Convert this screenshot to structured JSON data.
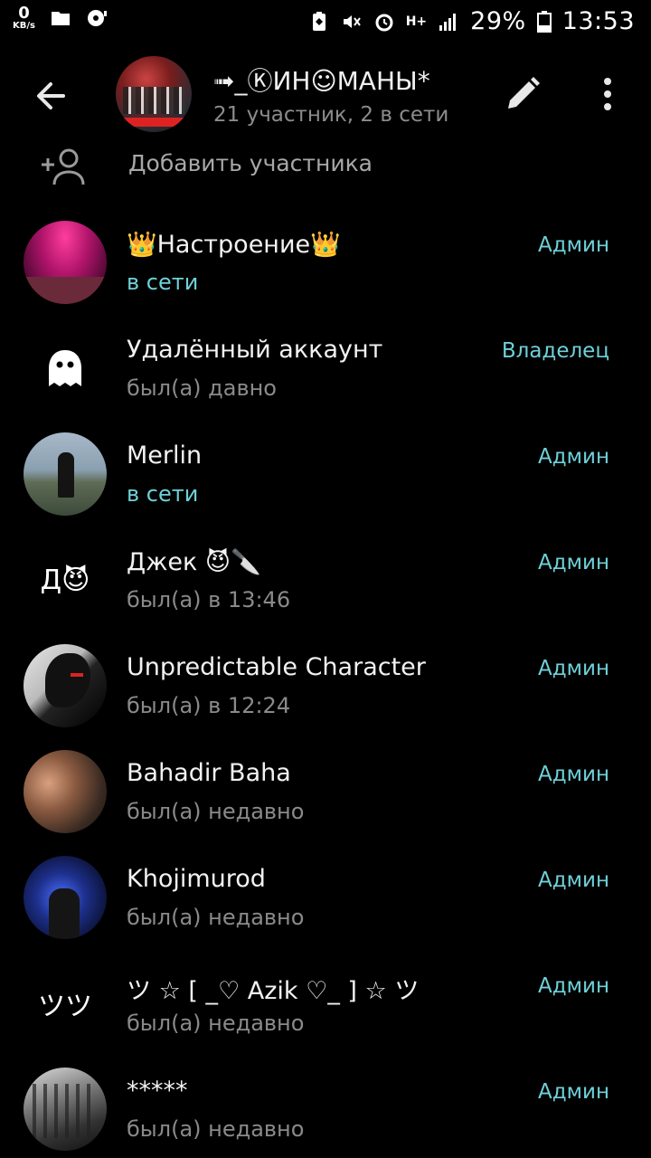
{
  "status_bar": {
    "speed_value": "0",
    "speed_unit": "KB/s",
    "network": "H+",
    "battery": "29%",
    "time": "13:53"
  },
  "header": {
    "title": "➟_ⓀИН☺МАНЫ*",
    "subtitle": "21 участник, 2 в сети"
  },
  "add_member": {
    "label": "Добавить участника"
  },
  "members": [
    {
      "name": "👑Настроение👑",
      "status": "в сети",
      "online": true,
      "role": "Админ",
      "avatar": "photo"
    },
    {
      "name": "Удалённый аккаунт",
      "status": "был(а) давно",
      "online": false,
      "role": "Владелец",
      "avatar": "ghost-icon"
    },
    {
      "name": "Merlin",
      "status": "в сети",
      "online": true,
      "role": "Админ",
      "avatar": "photo"
    },
    {
      "name": "Джек 😈🔪",
      "status": "был(а) в 13:46",
      "online": false,
      "role": "Админ",
      "avatar_text": "Д😈"
    },
    {
      "name": "Unpredictable Character",
      "status": "был(а) в 12:24",
      "online": false,
      "role": "Админ",
      "avatar": "photo"
    },
    {
      "name": "Bahadir Baha",
      "status": "был(а) недавно",
      "online": false,
      "role": "Админ",
      "avatar": "photo"
    },
    {
      "name": "Khojimurod",
      "status": "был(а) недавно",
      "online": false,
      "role": "Админ",
      "avatar": "photo"
    },
    {
      "name": "ツ ☆ [ _♡ Azik ♡_ ] ☆ ツ",
      "status": "был(а) недавно",
      "online": false,
      "role": "Админ",
      "avatar_text": "ツツ"
    },
    {
      "name": "*****",
      "status": "был(а) недавно",
      "online": false,
      "role": "Админ",
      "avatar": "photo"
    }
  ],
  "colors": {
    "background": "#000000",
    "accent": "#6fd0d8",
    "secondary_text": "#8a8a8a"
  }
}
